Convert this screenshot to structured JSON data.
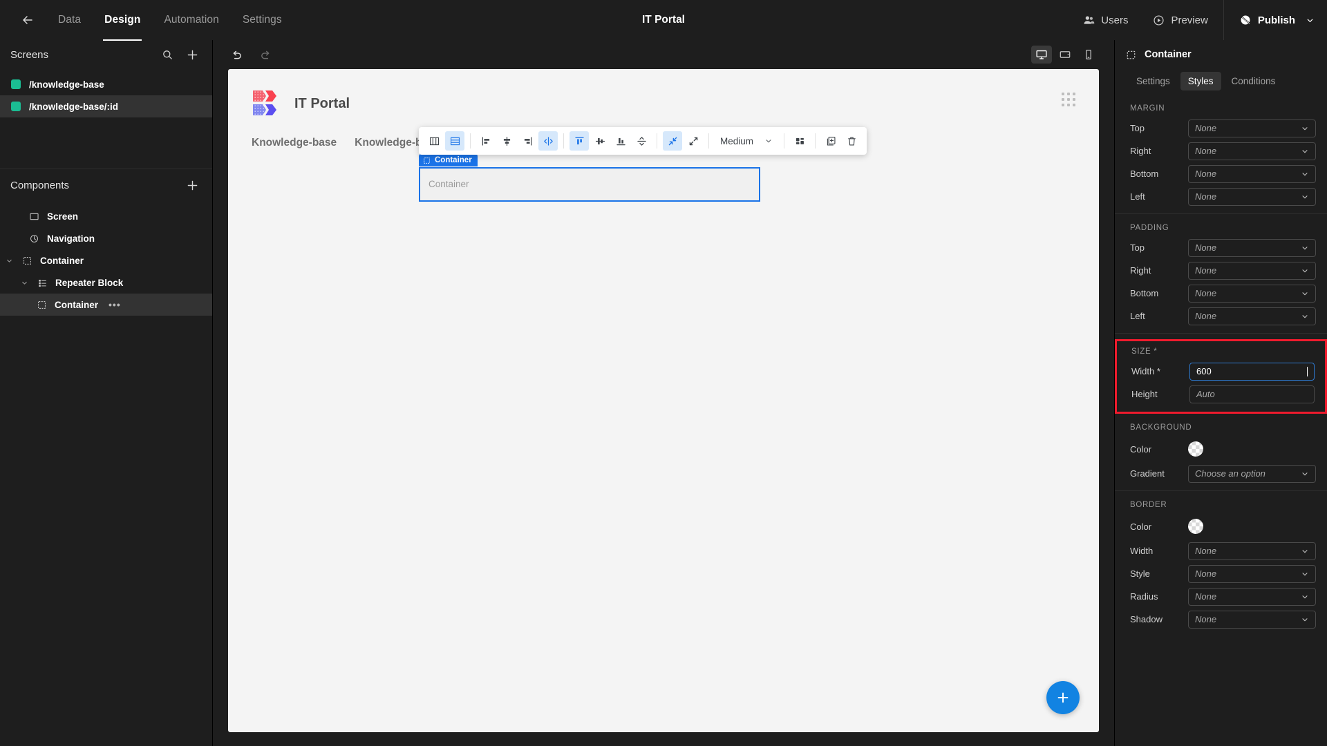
{
  "topbar": {
    "back_icon": "arrow-left-icon",
    "nav": [
      {
        "label": "Data",
        "active": false
      },
      {
        "label": "Design",
        "active": true
      },
      {
        "label": "Automation",
        "active": false
      },
      {
        "label": "Settings",
        "active": false
      }
    ],
    "app_title": "IT Portal",
    "users_label": "Users",
    "preview_label": "Preview",
    "publish_label": "Publish"
  },
  "sidebar": {
    "screens_title": "Screens",
    "screens": [
      {
        "label": "/knowledge-base",
        "selected": false,
        "color": "#1bbd93"
      },
      {
        "label": "/knowledge-base/:id",
        "selected": true,
        "color": "#1bbd93"
      }
    ],
    "components_title": "Components",
    "tree": [
      {
        "label": "Screen",
        "icon": "screen-icon",
        "depth": 0,
        "caret": "",
        "selected": false
      },
      {
        "label": "Navigation",
        "icon": "navigation-icon",
        "depth": 0,
        "caret": "",
        "selected": false
      },
      {
        "label": "Container",
        "icon": "container-icon",
        "depth": 0,
        "caret": "v",
        "selected": false
      },
      {
        "label": "Repeater Block",
        "icon": "repeater-icon",
        "depth": 1,
        "caret": "v",
        "selected": false
      },
      {
        "label": "Container",
        "icon": "container-icon",
        "depth": 2,
        "caret": "",
        "selected": true,
        "menu": "•••"
      }
    ]
  },
  "canvas": {
    "undo_icon": "undo-icon",
    "redo_icon": "redo-icon",
    "devices": [
      {
        "name": "desktop",
        "active": true
      },
      {
        "name": "tablet",
        "active": false
      },
      {
        "name": "mobile",
        "active": false
      }
    ],
    "logo_title": "IT Portal",
    "nav_links": [
      "Knowledge-base",
      "Knowledge-base"
    ],
    "selected_badge": "Container",
    "selected_placeholder": "Container",
    "fab_icon": "plus-icon",
    "toolbar": {
      "size_label": "Medium",
      "items": [
        {
          "name": "layout-columns-icon",
          "active": false
        },
        {
          "name": "layout-rows-icon",
          "active": true
        },
        {
          "name": "align-left-icon",
          "active": false
        },
        {
          "name": "align-center-horizontal-icon",
          "active": false
        },
        {
          "name": "align-right-icon",
          "active": false
        },
        {
          "name": "distribute-horizontal-icon",
          "active": true
        },
        {
          "name": "align-top-icon",
          "active": true
        },
        {
          "name": "align-middle-icon",
          "active": false
        },
        {
          "name": "align-bottom-icon",
          "active": false
        },
        {
          "name": "distribute-vertical-icon",
          "active": false
        },
        {
          "name": "collapse-icon",
          "active": true
        },
        {
          "name": "expand-icon",
          "active": false
        },
        {
          "name": "grid-icon",
          "active": false
        },
        {
          "name": "duplicate-icon",
          "active": false
        },
        {
          "name": "delete-icon",
          "active": false
        }
      ]
    }
  },
  "rightpanel": {
    "title": "Container",
    "tabs": [
      {
        "label": "Settings",
        "active": false
      },
      {
        "label": "Styles",
        "active": true
      },
      {
        "label": "Conditions",
        "active": false
      }
    ],
    "sections": [
      {
        "title": "MARGIN",
        "rows": [
          {
            "label": "Top",
            "value": "None",
            "type": "select"
          },
          {
            "label": "Right",
            "value": "None",
            "type": "select"
          },
          {
            "label": "Bottom",
            "value": "None",
            "type": "select"
          },
          {
            "label": "Left",
            "value": "None",
            "type": "select"
          }
        ]
      },
      {
        "title": "PADDING",
        "rows": [
          {
            "label": "Top",
            "value": "None",
            "type": "select"
          },
          {
            "label": "Right",
            "value": "None",
            "type": "select"
          },
          {
            "label": "Bottom",
            "value": "None",
            "type": "select"
          },
          {
            "label": "Left",
            "value": "None",
            "type": "select"
          }
        ]
      },
      {
        "title": "SIZE *",
        "highlight": true,
        "highlight_color": "#ef1b2d",
        "rows": [
          {
            "label": "Width *",
            "value": "600",
            "type": "text-focused"
          },
          {
            "label": "Height",
            "value": "Auto",
            "type": "text"
          }
        ]
      },
      {
        "title": "BACKGROUND",
        "rows": [
          {
            "label": "Color",
            "value": "",
            "type": "color"
          },
          {
            "label": "Gradient",
            "value": "Choose an option",
            "type": "select"
          }
        ]
      },
      {
        "title": "BORDER",
        "rows": [
          {
            "label": "Color",
            "value": "",
            "type": "color"
          },
          {
            "label": "Width",
            "value": "None",
            "type": "select"
          },
          {
            "label": "Style",
            "value": "None",
            "type": "select"
          },
          {
            "label": "Radius",
            "value": "None",
            "type": "select"
          },
          {
            "label": "Shadow",
            "value": "None",
            "type": "select"
          }
        ]
      }
    ]
  }
}
